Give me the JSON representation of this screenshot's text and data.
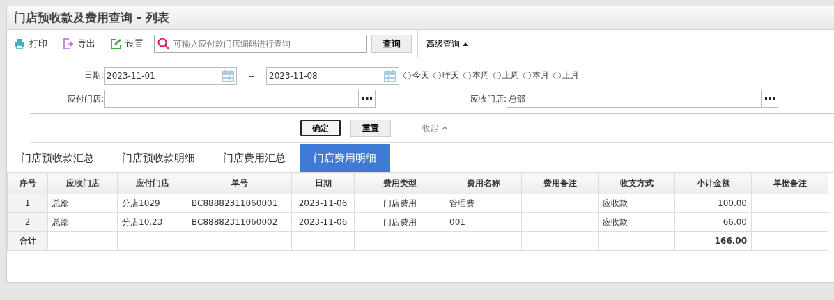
{
  "window": {
    "title": "门店预收款及费用查询 - 列表"
  },
  "toolbar": {
    "buttons": [
      {
        "kind": "print",
        "label": "打印"
      },
      {
        "kind": "export",
        "label": "导出"
      },
      {
        "kind": "settings",
        "label": "设置"
      }
    ],
    "search": {
      "placeholder": "可输入应付款门店编码进行查询"
    },
    "query_button": "查询",
    "advanced_button": {
      "label": "高级查询",
      "expanded": true
    }
  },
  "filters": {
    "date_label": "日期:",
    "date_from": "2023-11-01",
    "separator": "--",
    "date_to": "2023-11-08",
    "quick_ranges": [
      {
        "label": "今天",
        "selected": false
      },
      {
        "label": "昨天",
        "selected": false
      },
      {
        "label": "本周",
        "selected": false
      },
      {
        "label": "上周",
        "selected": false
      },
      {
        "label": "本月",
        "selected": false
      },
      {
        "label": "上月",
        "selected": false
      }
    ],
    "payer_store_label": "应付门店:",
    "receiver_store_label": "应收门店:",
    "receiver_store": "总部",
    "confirm_button": "确定",
    "reset_button": "重置",
    "collapse_link": "收起"
  },
  "tabs": [
    {
      "label": "门店预收款汇总",
      "selected": false
    },
    {
      "label": "门店预收款明细",
      "selected": false
    },
    {
      "label": "门店费用汇总",
      "selected": false
    },
    {
      "label": "门店费用明细",
      "selected": true
    }
  ],
  "table": {
    "columns": [
      "序号",
      "应收门店",
      "应付门店",
      "单号",
      "日期",
      "费用类型",
      "费用名称",
      "费用备注",
      "收支方式",
      "小计金额",
      "单据备注"
    ],
    "rows": [
      [
        "1",
        "总部",
        "分店1029",
        "BC88882311060001",
        "2023-11-06",
        "门店费用",
        "管理费",
        "",
        "应收款",
        "100.00",
        ""
      ],
      [
        "2",
        "总部",
        "分店10.23",
        "BC88882311060002",
        "2023-11-06",
        "门店费用",
        "001",
        "",
        "应收款",
        "66.00",
        ""
      ]
    ],
    "total_row": {
      "label": "合计",
      "amount": "166.00"
    }
  }
}
